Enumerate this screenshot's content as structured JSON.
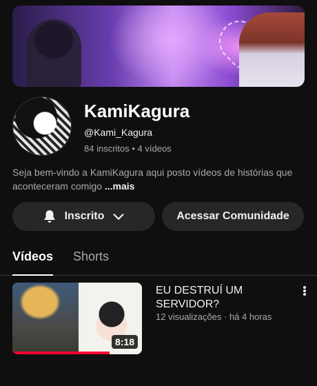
{
  "channel": {
    "name": "KamiKagura",
    "handle": "@Kami_Kagura",
    "stats": "84 inscritos • 4 vídeos",
    "description": "Seja bem-vindo a KamiKagura aqui posto vídeos de histórias que aconteceram comigo",
    "description_more": "...mais"
  },
  "buttons": {
    "subscribed": "Inscrito",
    "community": "Acessar Comunidade"
  },
  "tabs": [
    {
      "label": "Vídeos",
      "active": true
    },
    {
      "label": "Shorts",
      "active": false
    }
  ],
  "videos": [
    {
      "title": "EU DESTRUÍ UM SERVIDOR?",
      "meta": "12 visualizações · há 4 horas",
      "duration": "8:18",
      "watched_fraction": 0.75
    }
  ],
  "icons": {
    "bell": "bell-icon",
    "chevron": "chevron-down-icon",
    "more": "more-vertical-icon"
  },
  "colors": {
    "background": "#0f0f0f",
    "button": "#272727",
    "progress": "#ff0033"
  }
}
